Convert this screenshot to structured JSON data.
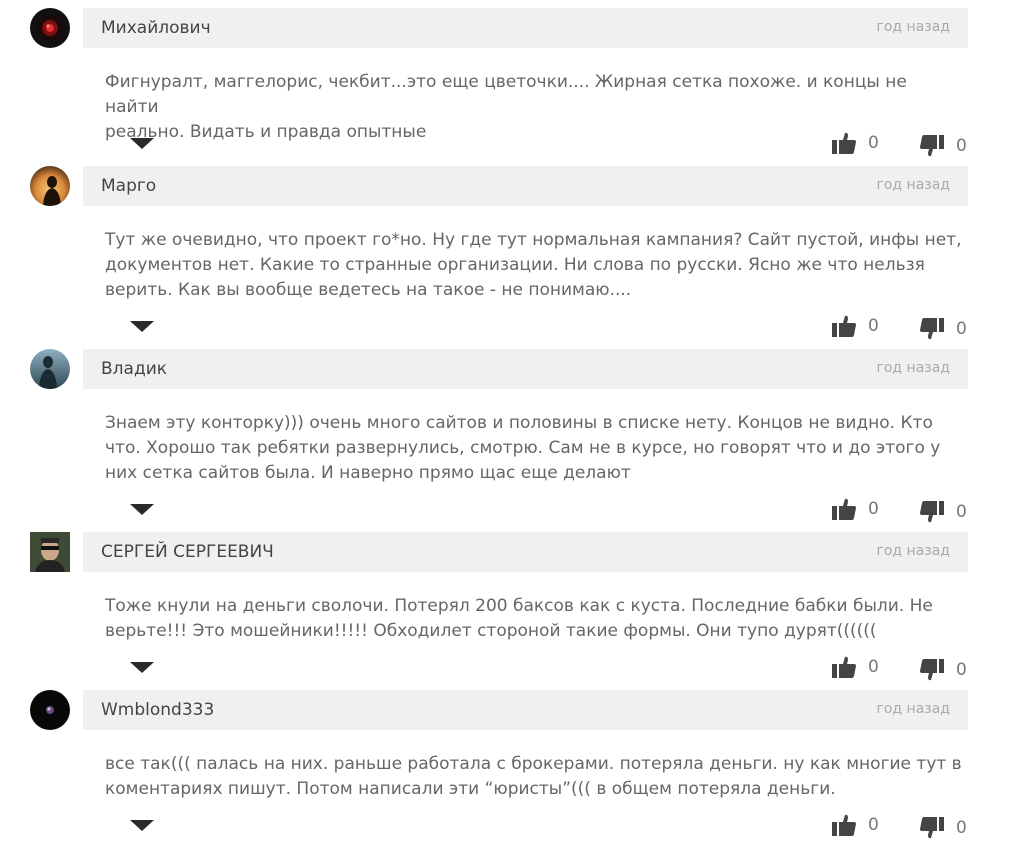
{
  "colors": {
    "header_bg": "#f0f0f0",
    "icon": "#444444",
    "text": "#666666",
    "meta": "#aaaaaa"
  },
  "icons": {
    "toggle": "caret-down-icon",
    "like": "thumb-up-icon",
    "dislike": "thumb-down-icon"
  },
  "comments": [
    {
      "author": "Михайлович",
      "time": "год назад",
      "text_lines": [
        "Фигнуралт, маггелорис, чекбит...это еще цветочки.... Жирная сетка похоже. и концы не найти",
        "реально. Видать и правда опытные"
      ],
      "likes": "0",
      "dislikes": "0"
    },
    {
      "author": "Марго",
      "time": "год назад",
      "text_lines": [
        "Тут же очевидно, что проект го*но. Ну где тут нормальная кампания? Сайт пустой, инфы нет,",
        "документов нет. Какие то странные организации. Ни слова по русски. Ясно же что нельзя",
        "верить. Как вы вообще ведетесь на такое - не понимаю...."
      ],
      "likes": "0",
      "dislikes": "0"
    },
    {
      "author": "Владик",
      "time": "год назад",
      "text_lines": [
        "Знаем эту конторку))) очень много сайтов и половины в списке нету. Концов не видно. Кто",
        "что. Хорошо так ребятки развернулись, смотрю. Сам не в курсе, но говорят что и до этого у",
        "них сетка сайтов была. И наверно прямо щас еще делают"
      ],
      "likes": "0",
      "dislikes": "0"
    },
    {
      "author": "СЕРГЕЙ СЕРГЕЕВИЧ",
      "time": "год назад",
      "text_lines": [
        "Тоже кнули на деньги сволочи. Потерял 200 баксов как с куста. Последние бабки были. Не",
        "верьте!!! Это мошейники!!!!! Обходилет стороной такие формы. Они тупо дурят(((((("
      ],
      "likes": "0",
      "dislikes": "0"
    },
    {
      "author": "Wmblond333",
      "time": "год назад",
      "text_lines": [
        "все так((( палась на них. раньше работала с брокерами. потеряла деньги. ну как многие тут в",
        "коментариях пишут. Потом написали эти “юристы”((( в общем потеряла деньги."
      ],
      "likes": "0",
      "dislikes": "0"
    }
  ]
}
